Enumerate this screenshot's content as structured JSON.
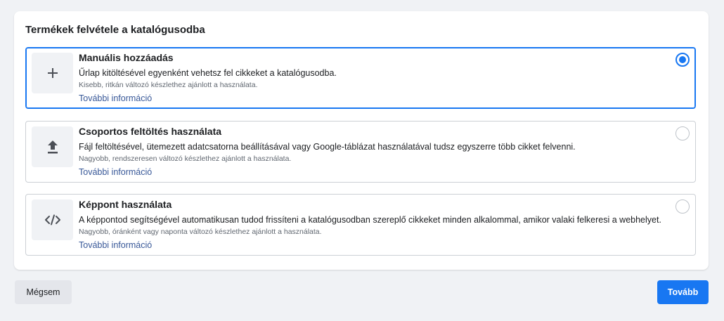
{
  "dialog": {
    "title": "Termékek felvétele a katalógusodba"
  },
  "options": [
    {
      "icon": "plus-icon",
      "title": "Manuális hozzáadás",
      "description": "Űrlap kitöltésével egyenként vehetsz fel cikkeket a katalógusodba.",
      "note": "Kisebb, ritkán változó készlethez ajánlott a használata.",
      "link": "További információ",
      "selected": true
    },
    {
      "icon": "upload-icon",
      "title": "Csoportos feltöltés használata",
      "description": "Fájl feltöltésével, ütemezett adatcsatorna beállításával vagy Google-táblázat használatával tudsz egyszerre több cikket felvenni.",
      "note": "Nagyobb, rendszeresen változó készlethez ajánlott a használata.",
      "link": "További információ",
      "selected": false
    },
    {
      "icon": "code-icon",
      "title": "Képpont használata",
      "description": "A képpontod segítségével automatikusan tudod frissíteni a katalógusodban szereplő cikkeket minden alkalommal, amikor valaki felkeresi a webhelyet.",
      "note": "Nagyobb, óránként vagy naponta változó készlethez ajánlott a használata.",
      "link": "További információ",
      "selected": false
    }
  ],
  "footer": {
    "cancel_label": "Mégsem",
    "next_label": "Tovább"
  },
  "colors": {
    "accent": "#1877f2",
    "link": "#385898",
    "page_background": "#f0f2f5"
  }
}
